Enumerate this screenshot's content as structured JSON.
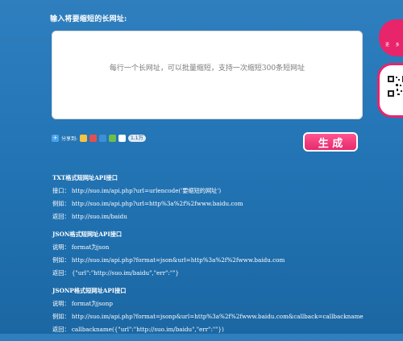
{
  "title": "输入将要缩短的长网址:",
  "input": {
    "placeholder": "每行一个长网址，可以批量缩短，支持一次缩短300条短网址"
  },
  "share": {
    "label": "分享到:",
    "count": "1.1万"
  },
  "generate_button": "生 成",
  "side_tab": {
    "label": "更 多"
  },
  "api_sections": [
    {
      "title": "TXT格式短网址API接口",
      "lines": [
        "接口： http://suo.im/api.php?url=urlencode('要缩短的网址')",
        "例如： http://suo.im/api.php?url=http%3a%2f%2fwww.baidu.com",
        "返回： http://suo.im/baidu"
      ]
    },
    {
      "title": "JSON格式短网址API接口",
      "lines": [
        "说明： format为json",
        "例如： http://suo.im/api.php?format=json&url=http%3a%2f%2fwww.baidu.com",
        "返回： {\"url\":\"http://suo.im/baidu\",\"err\":\"\"}"
      ]
    },
    {
      "title": "JSONP格式短网址API接口",
      "lines": [
        "说明： format为jsonp",
        "例如： http://suo.im/api.php?format=jsonp&url=http%3a%2f%2fwww.baidu.com&callback=callbackname",
        "返回： callbackname({\"url\":\"http://suo.im/baidu\",\"err\":\"\"})"
      ]
    }
  ],
  "colors": {
    "background": "#2476b6",
    "accent": "#e8246b"
  }
}
